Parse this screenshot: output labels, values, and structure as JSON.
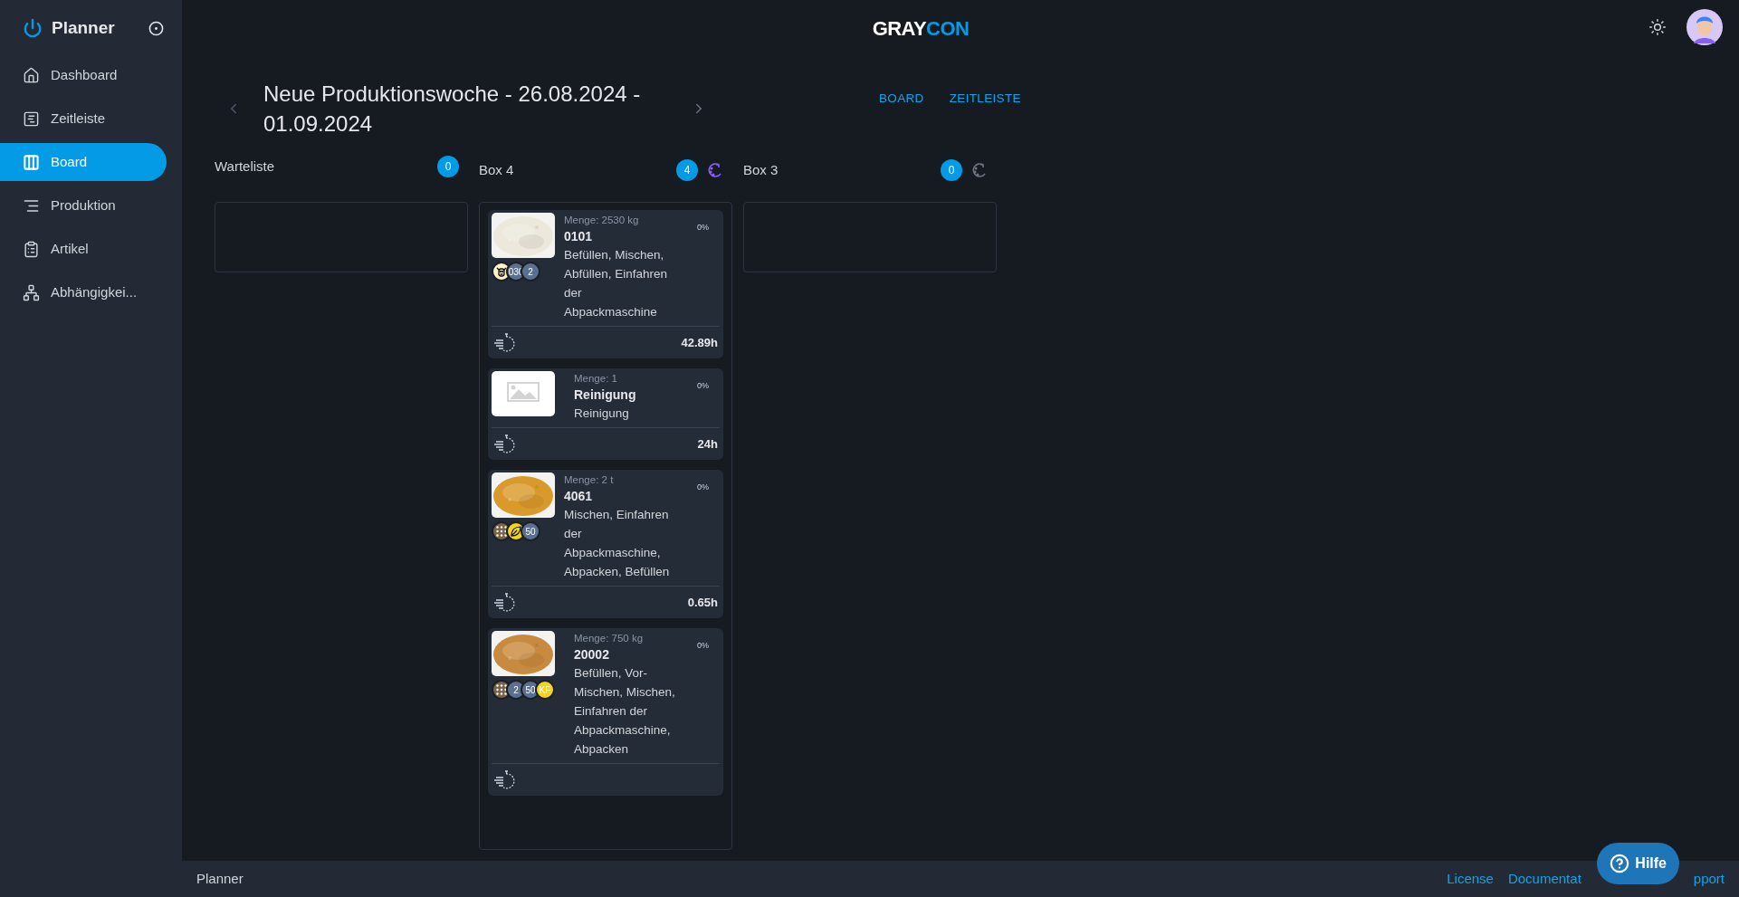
{
  "sidebar": {
    "title": "Planner",
    "items": [
      {
        "label": "Dashboard",
        "kind": "home",
        "selected": false
      },
      {
        "label": "Zeitleiste",
        "kind": "timeline",
        "selected": false
      },
      {
        "label": "Board",
        "kind": "board",
        "selected": true
      },
      {
        "label": "Produktion",
        "kind": "production",
        "selected": false
      },
      {
        "label": "Artikel",
        "kind": "clipboard",
        "selected": false
      },
      {
        "label": "Abhängigkei...",
        "kind": "tree",
        "selected": false
      }
    ]
  },
  "header": {
    "logo": [
      "GRAY",
      "CON"
    ]
  },
  "week": {
    "title": "Neue Produktionswoche - 26.08.2024 - 01.09.2024"
  },
  "view_tabs": [
    {
      "label": "BOARD"
    },
    {
      "label": "ZEITLEISTE"
    }
  ],
  "columns": [
    {
      "title": "Warteliste",
      "count": "0"
    },
    {
      "title": "Box 4",
      "count": "4",
      "sort_active": true,
      "cards": [
        {
          "image": {
            "kind": "picture"
          },
          "quantity": "Menge: 2530 kg",
          "name": "0101",
          "steps": "Befüllen, Mischen, Abfüllen, Einfahren der Abpackmaschine",
          "progress": "0%",
          "duration": "42.89h",
          "badges": [
            {
              "kind": "cow",
              "color": "#fdf3c4"
            },
            {
              "kind": "text",
              "text": "030",
              "color": "#5b6f8f"
            },
            {
              "kind": "text",
              "text": "2",
              "color": "#5b6f8f"
            }
          ]
        },
        {
          "quantity": "Menge: 1",
          "name": "Reinigung",
          "steps": "Reinigung",
          "progress": "0%",
          "duration": "24h"
        },
        {
          "image": {
            "kind": "picture"
          },
          "quantity": "Menge: 2 t",
          "name": "4061",
          "steps": "Mischen, Einfahren der Abpackmaschine, Abpacken, Befüllen",
          "progress": "0%",
          "duration": "0.65h",
          "badges": [
            {
              "kind": "grid",
              "color": "#7a6446"
            },
            {
              "kind": "leaf",
              "color": "#f5d21c"
            },
            {
              "kind": "text",
              "text": "50",
              "color": "#5b6f8f"
            }
          ]
        },
        {
          "image": {
            "kind": "picture"
          },
          "quantity": "Menge: 750 kg",
          "name": "20002",
          "steps": "Befüllen, Vor-Mischen, Mischen, Einfahren der Abpackmaschine, Abpacken",
          "progress": "0%",
          "badges": [
            {
              "kind": "grid",
              "color": "#7a6446"
            },
            {
              "kind": "text",
              "text": "2",
              "color": "#5b6f8f"
            },
            {
              "kind": "text",
              "text": "50",
              "color": "#5b6f8f"
            },
            {
              "kind": "text",
              "text": "KF",
              "color": "#f5d21c"
            }
          ]
        }
      ]
    },
    {
      "title": "Box 3",
      "count": "0",
      "sort_active": false
    }
  ],
  "footer": {
    "app": "Planner",
    "links": [
      "License",
      "Documentat",
      "pport"
    ]
  },
  "help_button": {
    "label": "Hilfe"
  }
}
